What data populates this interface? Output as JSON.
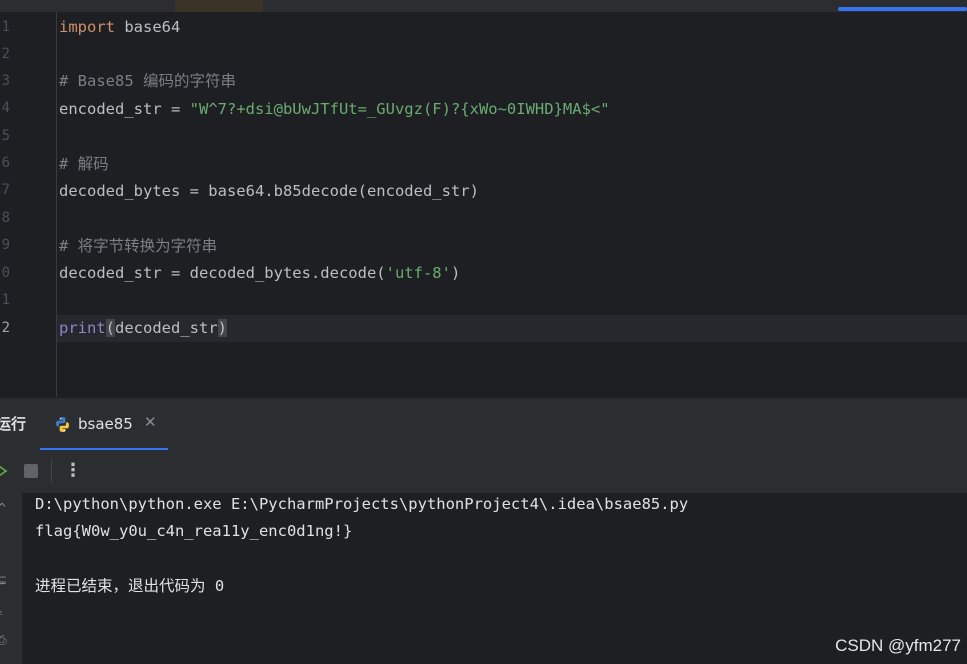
{
  "editor": {
    "line_numbers": [
      "1",
      "2",
      "3",
      "4",
      "5",
      "6",
      "7",
      "8",
      "9",
      "0",
      "1",
      "2"
    ],
    "lines": {
      "l1_kw": "import",
      "l1_rest": " base64",
      "l3_comment": "# Base85 编码的字符串",
      "l4_var": "encoded_str = ",
      "l4_str": "\"W^7?+dsi@bUwJTfUt=_GUvgz(F)?{xWo~0IWHD}MA$<\"",
      "l6_comment": "# 解码",
      "l7_code": "decoded_bytes = base64.b85decode(encoded_str)",
      "l9_comment": "# 将字节转换为字符串",
      "l10_code_a": "decoded_str = decoded_bytes.decode(",
      "l10_str": "'utf-8'",
      "l10_code_b": ")",
      "l12_builtin": "print",
      "l12_open": "(",
      "l12_arg": "decoded_str",
      "l12_close": ")"
    }
  },
  "run_panel": {
    "title": "运行",
    "tab_label": "bsae85",
    "tab_close": "✕",
    "more_label": "⋮"
  },
  "console": {
    "command": "D:\\python\\python.exe E:\\PycharmProjects\\pythonProject4\\.idea\\bsae85.py",
    "output": "flag{W0w_y0u_c4n_rea11y_enc0d1ng!}",
    "exit_message": "进程已结束，退出代码为 0"
  },
  "watermark": "CSDN @yfm277",
  "colors": {
    "background": "#1e1f22",
    "keyword": "#cf8e6d",
    "comment": "#7a7e85",
    "string": "#6aab73",
    "builtin": "#8888c6",
    "accent": "#3574f0"
  }
}
